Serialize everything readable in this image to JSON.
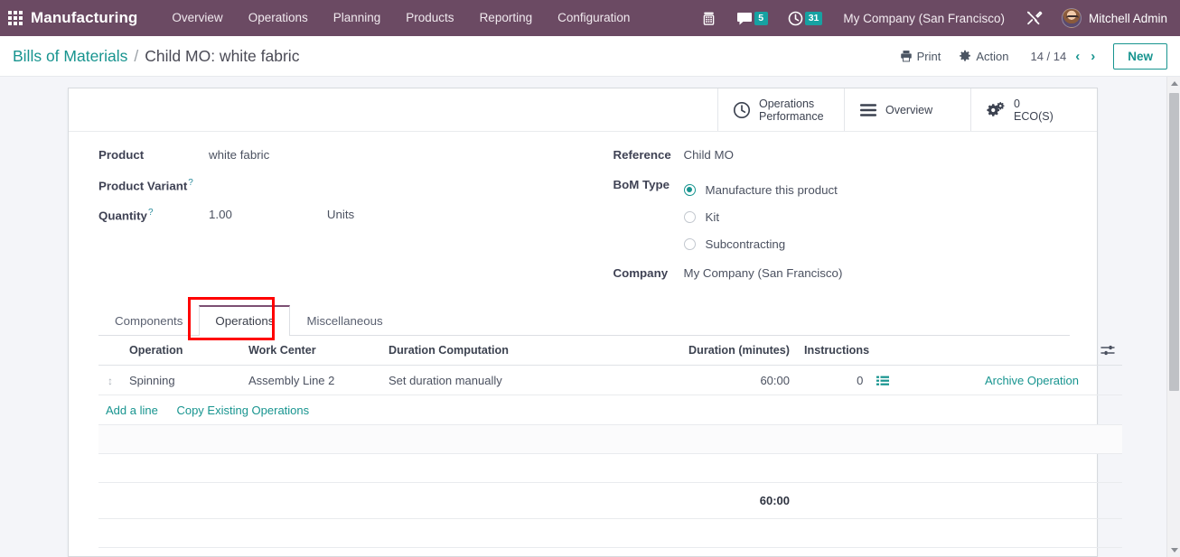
{
  "navbar": {
    "apps_icon": "apps-grid-icon",
    "brand": "Manufacturing",
    "menu": [
      {
        "label": "Overview"
      },
      {
        "label": "Operations"
      },
      {
        "label": "Planning"
      },
      {
        "label": "Products"
      },
      {
        "label": "Reporting"
      },
      {
        "label": "Configuration"
      }
    ],
    "icons": {
      "phone": "phone-icon",
      "messages": "chat-icon",
      "activities": "clock-icon",
      "tools": "tools-icon"
    },
    "messages_count": "5",
    "activities_count": "31",
    "company": "My Company (San Francisco)",
    "user": "Mitchell Admin"
  },
  "control_panel": {
    "breadcrumb_root": "Bills of Materials",
    "breadcrumb_sep": "/",
    "breadcrumb_current": "Child MO: white fabric",
    "print_label": "Print",
    "action_label": "Action",
    "pager": "14 / 14",
    "prev_arrow": "‹",
    "next_arrow": "›",
    "new_label": "New"
  },
  "stat_buttons": [
    {
      "icon": "clock-icon",
      "line1": "Operations",
      "line2": "Performance"
    },
    {
      "icon": "list-icon",
      "line1": "Overview",
      "line2": ""
    },
    {
      "icon": "gears-icon",
      "line1": "0",
      "line2": "ECO(S)"
    }
  ],
  "form": {
    "left": {
      "product_label": "Product",
      "product_value": "white fabric",
      "variant_label": "Product Variant",
      "variant_value": "",
      "quantity_label": "Quantity",
      "quantity_value": "1.00",
      "uom_value": "Units",
      "help_marker": "?"
    },
    "right": {
      "reference_label": "Reference",
      "reference_value": "Child MO",
      "bom_type_label": "BoM Type",
      "bom_type_options": [
        {
          "label": "Manufacture this product",
          "selected": true
        },
        {
          "label": "Kit",
          "selected": false
        },
        {
          "label": "Subcontracting",
          "selected": false
        }
      ],
      "company_label": "Company",
      "company_value": "My Company (San Francisco)"
    }
  },
  "notebook": {
    "tabs": [
      {
        "label": "Components",
        "active": false
      },
      {
        "label": "Operations",
        "active": true
      },
      {
        "label": "Miscellaneous",
        "active": false
      }
    ],
    "highlighted_tab": "Operations"
  },
  "operations_table": {
    "headers": [
      "Operation",
      "Work Center",
      "Duration Computation",
      "Duration (minutes)",
      "Instructions"
    ],
    "optional_columns_icon": "sliders-icon",
    "rows": [
      {
        "handle": "drag-handle",
        "operation": "Spinning",
        "work_center": "Assembly Line 2",
        "duration_computation": "Set duration manually",
        "duration": "60:00",
        "instructions": "0",
        "instructions_icon": "list-icon",
        "archive_label": "Archive Operation"
      }
    ],
    "add_line_label": "Add a line",
    "copy_existing_label": "Copy Existing Operations",
    "total_duration": "60:00"
  },
  "colors": {
    "navbar_purple": "#6b4a63",
    "accent_teal": "#17948f",
    "badge_teal": "#17a2a2",
    "highlight_red": "#ff0000",
    "tab_active_border": "#7c4f73",
    "page_bg": "#f4f5f9"
  }
}
